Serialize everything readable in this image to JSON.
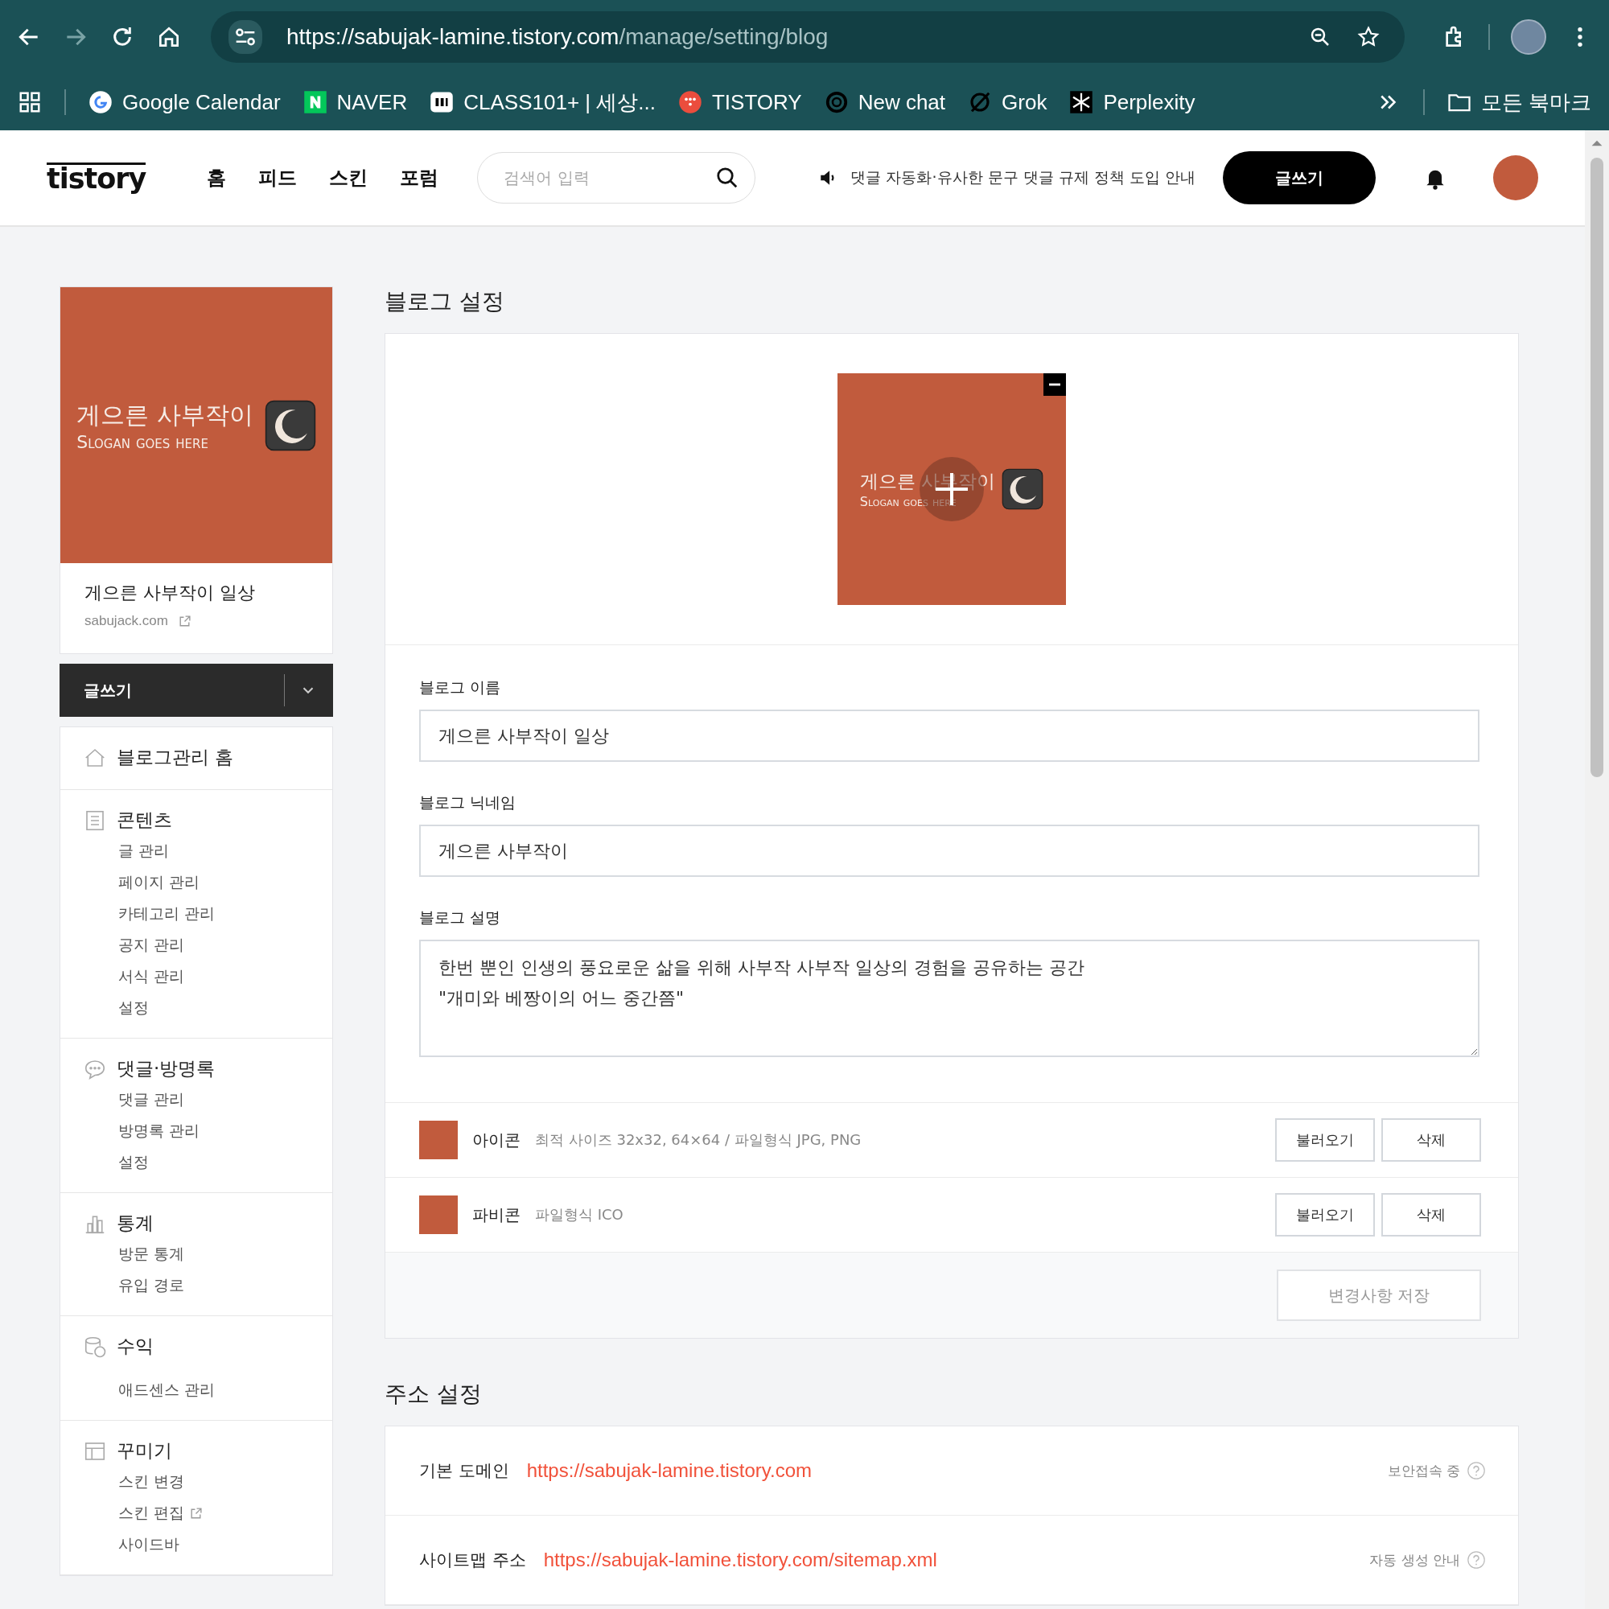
{
  "browser": {
    "url_host": "https://sabujak-lamine.tistory.com",
    "url_path": "/manage/setting/blog",
    "bookmarks": [
      {
        "label": "Google Calendar",
        "kind": "google"
      },
      {
        "label": "NAVER",
        "kind": "naver"
      },
      {
        "label": "CLASS101+ | 세상...",
        "kind": "class"
      },
      {
        "label": "TISTORY",
        "kind": "tistory"
      },
      {
        "label": "New chat",
        "kind": "knot"
      },
      {
        "label": "Grok",
        "kind": "slash"
      },
      {
        "label": "Perplexity",
        "kind": "star"
      }
    ],
    "folder": "모든 북마크"
  },
  "header": {
    "logo": "tistory",
    "nav": [
      "홈",
      "피드",
      "스킨",
      "포럼"
    ],
    "search_placeholder": "검색어 입력",
    "notice": "댓글 자동화·유사한 문구 댓글 규제 정책 도입 안내",
    "write_button": "글쓰기"
  },
  "sidebar": {
    "banner": {
      "title": "게으른 사부작이",
      "slogan": "Slogan goes here"
    },
    "blog_name": "게으른 사부작이 일상",
    "domain": "sabujack.com",
    "write_button": "글쓰기",
    "menu": [
      {
        "label": "블로그관리 홈",
        "kind": "house"
      },
      {
        "label": "콘텐츠",
        "kind": "document",
        "children": [
          {
            "label": "글 관리",
            "external": false
          },
          {
            "label": "페이지 관리",
            "external": false
          },
          {
            "label": "카테고리 관리",
            "external": false
          },
          {
            "label": "공지 관리",
            "external": false
          },
          {
            "label": "서식 관리",
            "external": false
          },
          {
            "label": "설정",
            "external": false
          }
        ]
      },
      {
        "label": "댓글·방명록",
        "kind": "speech",
        "children": [
          {
            "label": "댓글 관리",
            "external": false
          },
          {
            "label": "방명록 관리",
            "external": false
          },
          {
            "label": "설정",
            "external": false
          }
        ]
      },
      {
        "label": "통계",
        "kind": "chart",
        "children": [
          {
            "label": "방문 통계",
            "external": false
          },
          {
            "label": "유입 경로",
            "external": false
          }
        ]
      },
      {
        "label": "수익",
        "kind": "coins",
        "children": [
          {
            "label": "애드센스 관리",
            "external": false
          }
        ]
      },
      {
        "label": "꾸미기",
        "kind": "layout",
        "children": [
          {
            "label": "스킨 변경",
            "external": false
          },
          {
            "label": "스킨 편집",
            "external": true
          },
          {
            "label": "사이드바",
            "external": false
          }
        ]
      }
    ]
  },
  "blog_settings": {
    "title": "블로그 설정",
    "banner": {
      "title": "게으른 사부작이",
      "slogan": "Slogan goes here"
    },
    "fields": [
      {
        "label": "블로그 이름",
        "value": "게으른 사부작이 일상",
        "kind": "input"
      },
      {
        "label": "블로그 닉네임",
        "value": "게으른 사부작이",
        "kind": "input"
      },
      {
        "label": "블로그 설명",
        "value": "한번 뿐인 인생의 풍요로운 삶을 위해 사부작 사부작 일상의 경험을 공유하는 공간\n\"개미와 베짱이의 어느 중간쯤\"",
        "kind": "textarea"
      }
    ],
    "images": [
      {
        "label": "아이콘",
        "hint": "최적 사이즈 32x32, 64×64 / 파일형식 JPG, PNG",
        "buttons": [
          "불러오기",
          "삭제"
        ]
      },
      {
        "label": "파비콘",
        "hint": "파일형식 ICO",
        "buttons": [
          "불러오기",
          "삭제"
        ]
      }
    ],
    "save_button": {
      "label": "변경사항 저장",
      "disabled": true
    }
  },
  "address_settings": {
    "title": "주소 설정",
    "rows": [
      {
        "label": "기본 도메인",
        "url": "https://sabujak-lamine.tistory.com",
        "note": "보안접속 중"
      },
      {
        "label": "사이트맵 주소",
        "url": "https://sabujak-lamine.tistory.com/sitemap.xml",
        "note": "자동 생성 안내"
      }
    ]
  }
}
